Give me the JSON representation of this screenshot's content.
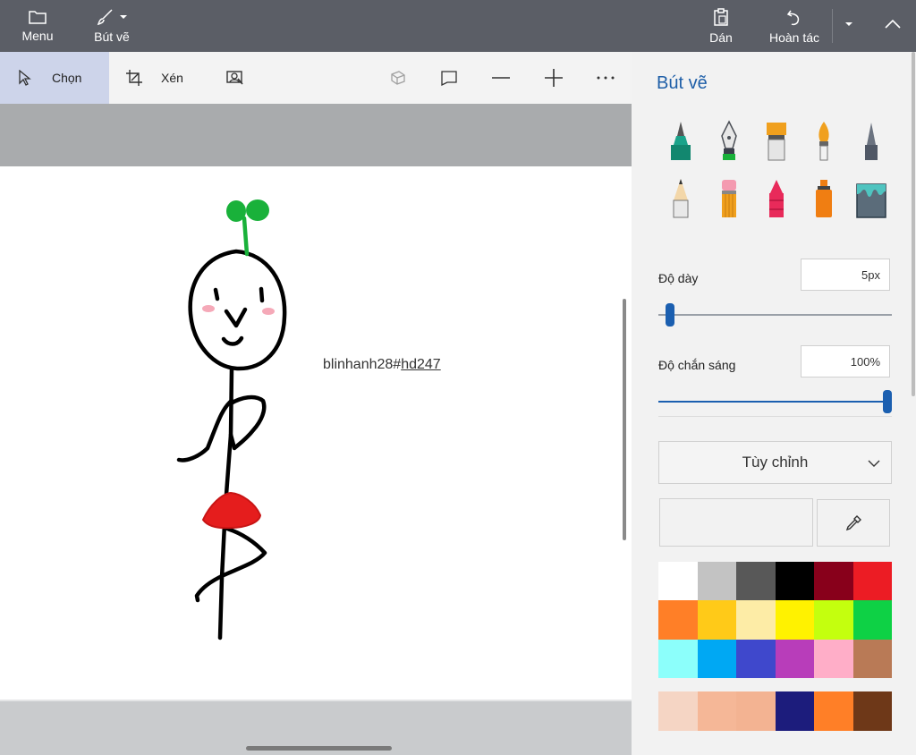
{
  "topbar": {
    "menu_label": "Menu",
    "brush_label": "Bút vẽ",
    "paste_label": "Dán",
    "undo_label": "Hoàn tác"
  },
  "toolbar": {
    "select_label": "Chọn",
    "crop_label": "Xén"
  },
  "canvas": {
    "text": "blinhanh28#",
    "text_underlined": "hd247"
  },
  "panel": {
    "title": "Bút vẽ",
    "thickness_label": "Độ dày",
    "thickness_value": "5px",
    "thickness_level": 0.03,
    "opacity_label": "Độ chắn sáng",
    "opacity_value": "100%",
    "opacity_level": 1.0,
    "color_mode": "Tùy chỉnh",
    "accent_color": "#1b5fb0",
    "brushes": [
      "calligraphy-pen",
      "fountain-pen",
      "oil-brush",
      "watercolor-brush",
      "pencil-marker",
      "pencil",
      "eraser",
      "crayon",
      "spray-can",
      "fill-bucket"
    ],
    "palette": [
      "#ffffff",
      "#c3c3c3",
      "#585858",
      "#000000",
      "#88001b",
      "#ec1c24",
      "#ff7f27",
      "#ffca18",
      "#fdeca6",
      "#fff200",
      "#c4ff0e",
      "#0ed145",
      "#8cfffb",
      "#00a8f3",
      "#3f48cc",
      "#b83dba",
      "#ffaec8",
      "#b97a56"
    ],
    "palette_custom": [
      "#f5d5c4",
      "#f5b797",
      "#f3b392",
      "#1c1c7c",
      "#ff7f27",
      "#6e3818"
    ]
  }
}
